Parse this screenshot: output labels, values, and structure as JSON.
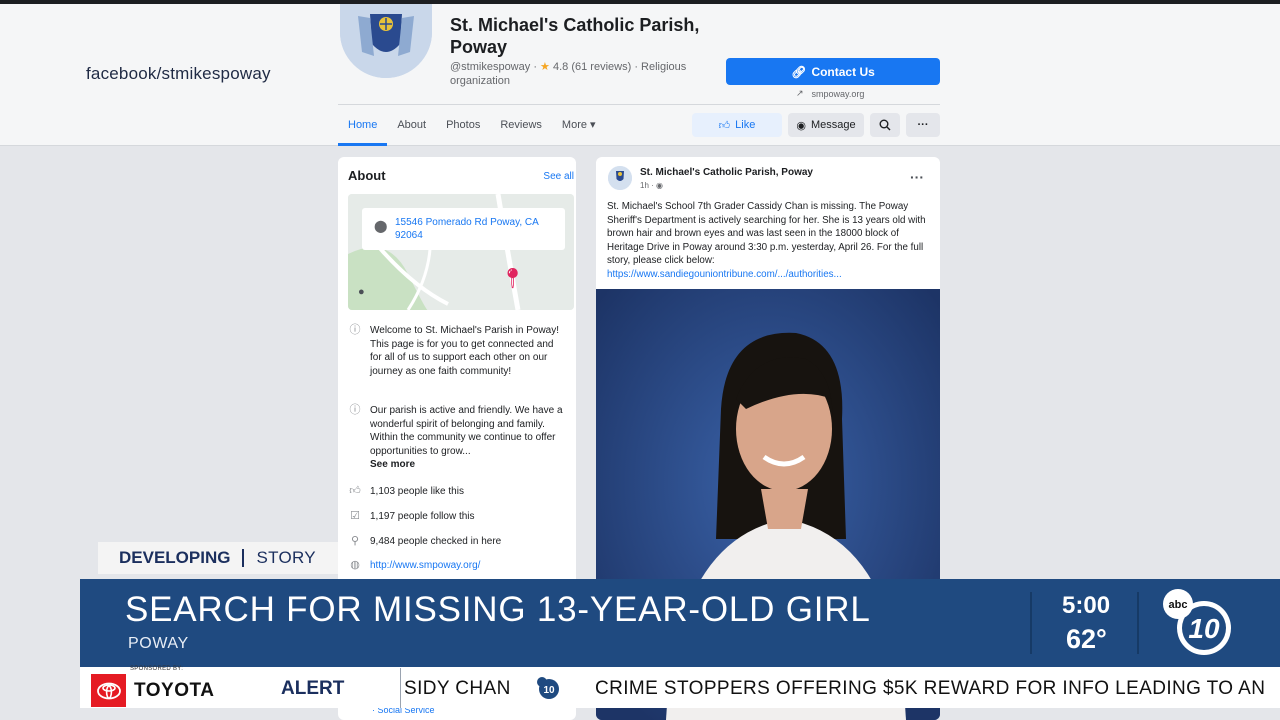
{
  "header": {
    "fb_url": "facebook/stmikespoway",
    "page_name": "St. Michael's Catholic Parish, Poway",
    "handle": "@stmikespoway",
    "rating": "4.8 (61 reviews)",
    "category": "Religious organization",
    "contact_label": "Contact Us",
    "website": "smpoway.org"
  },
  "tabs": [
    {
      "label": "Home"
    },
    {
      "label": "About"
    },
    {
      "label": "Photos"
    },
    {
      "label": "Reviews"
    },
    {
      "label": "More"
    }
  ],
  "actions": {
    "like_label": "Like",
    "message_label": "Message"
  },
  "about": {
    "title": "About",
    "see_all": "See all",
    "address": "15546 Pomerado Rd Poway, CA 92064",
    "welcome": "Welcome to St. Michael's Parish in Poway! This page is for you to get connected and for all of us to support each other on our journey as one faith community!",
    "description": "Our parish is active and friendly. We have a wonderful spirit of belonging and family. Within the community we continue to offer opportunities to grow...",
    "see_more": "See more",
    "likes": "1,103 people like this",
    "follows": "1,197 people follow this",
    "checkins": "9,484 people checked in here",
    "website": "http://www.smpoway.org/",
    "social_service": "· Social Service"
  },
  "post": {
    "author": "St. Michael's Catholic Parish, Poway",
    "time": "1h · ",
    "body": "St. Michael's School 7th Grader Cassidy Chan is missing. The Poway Sheriff's Department is actively searching for her. She is 13 years old with brown hair and brown eyes and was last seen in the 18000 block of Heritage Drive in Poway around 3:30 p.m. yesterday, April 26. For the full story, please click below:",
    "link": "https://www.sandiegouniontribune.com/.../authorities..."
  },
  "news": {
    "developing": "DEVELOPING",
    "story": "STORY",
    "headline": "SEARCH FOR MISSING 13-YEAR-OLD GIRL",
    "location": "POWAY",
    "time": "5:00",
    "temp": "62°",
    "sponsored": "SPONSORED BY:",
    "sponsor": "TOYOTA",
    "alert": "ALERT",
    "ticker1": "SIDY CHAN",
    "ticker2": "CRIME STOPPERS OFFERING $5K REWARD FOR INFO LEADING TO AN",
    "station_logo_text": "10",
    "network_logo_text": "abc"
  },
  "colors": {
    "facebook_blue": "#1877f2",
    "news_navy": "#1f4a80",
    "toyota_red": "#e51b23"
  },
  "icons": [
    "parish-logo-icon",
    "star-icon",
    "link-icon",
    "external-link-icon",
    "thumbs-up-icon",
    "messenger-icon",
    "search-icon",
    "more-dots-icon",
    "location-pin-icon",
    "info-icon",
    "like-icon",
    "follow-icon",
    "checkin-icon",
    "globe-icon",
    "toyota-logo-icon",
    "abc10-logo-icon"
  ]
}
